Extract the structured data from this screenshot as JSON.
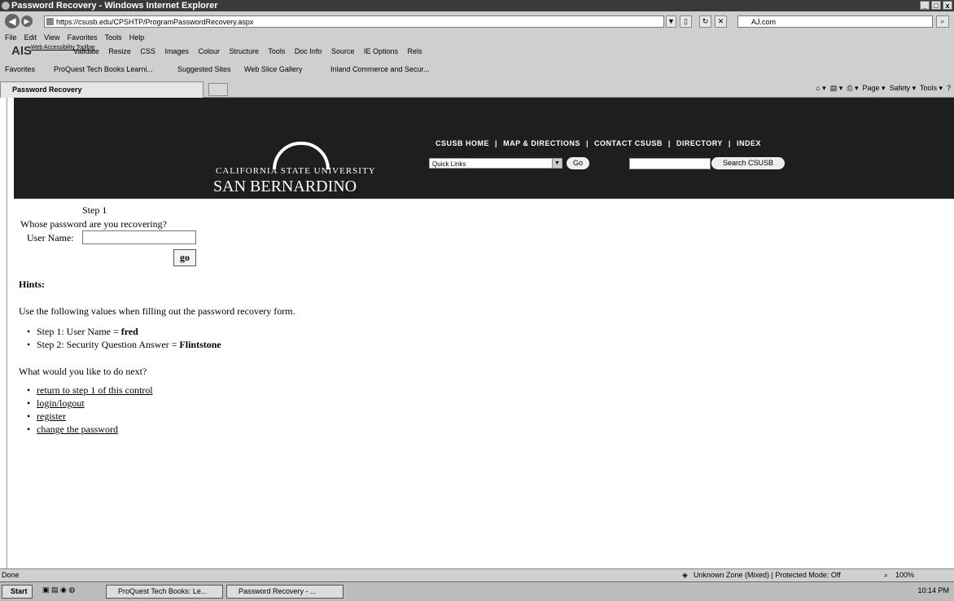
{
  "window": {
    "title": "Password Recovery - Windows Internet Explorer",
    "address": "https://csusb.edu/CPSHTP/ProgramPasswordRecovery.aspx",
    "search_box": "AJ.com",
    "tab_title": "Password Recovery"
  },
  "menu": [
    "File",
    "Edit",
    "View",
    "Favorites",
    "Tools",
    "Help"
  ],
  "ais_toolbar": {
    "logo": "AIS",
    "subtitle": "Web Accessibility Toolbar",
    "items": [
      "Validate",
      "Resize",
      "CSS",
      "Images",
      "Colour",
      "Structure",
      "Tools",
      "Doc Info",
      "Source",
      "IE Options",
      "Rels"
    ]
  },
  "favorites": {
    "label": "Favorites",
    "items": [
      "ProQuest Tech Books Learni...",
      "Suggested Sites",
      "Web Slice Gallery",
      "Inland Commerce and Secur..."
    ]
  },
  "command_bar": [
    "Page",
    "Safety",
    "Tools"
  ],
  "banner": {
    "univ_line": "CALIFORNIA STATE UNIVERSITY",
    "name_line": "SAN BERNARDINO",
    "top_links": [
      "CSUSB HOME",
      "|",
      "MAP & DIRECTIONS",
      "|",
      "CONTACT CSUSB",
      "|",
      "DIRECTORY",
      "|",
      "INDEX"
    ],
    "quick_links": "Quick Links",
    "go": "Go",
    "search_button": "Search CSUSB"
  },
  "form": {
    "step": "Step 1",
    "question": "Whose password are you recovering?",
    "username_label": "User Name:",
    "go_button": "go"
  },
  "hints": {
    "heading": "Hints:",
    "intro": "Use the following values when filling out the password recovery form.",
    "items": [
      {
        "prefix": "Step 1: User Name = ",
        "value": "fred"
      },
      {
        "prefix": "Step 2: Security Question Answer = ",
        "value": "Flintstone"
      }
    ]
  },
  "next": {
    "heading": "What would you like to do next?",
    "links": [
      "return to step 1 of this control",
      "login/logout",
      "register",
      "change the password"
    ]
  },
  "status": {
    "left": "Done",
    "zone": "Unknown Zone (Mixed) | Protected Mode: Off",
    "zoom": "100%"
  },
  "taskbar": {
    "start": "Start",
    "tasks": [
      "ProQuest Tech Books: Le...",
      "Password Recovery - ..."
    ],
    "clock": "10:14 PM"
  }
}
